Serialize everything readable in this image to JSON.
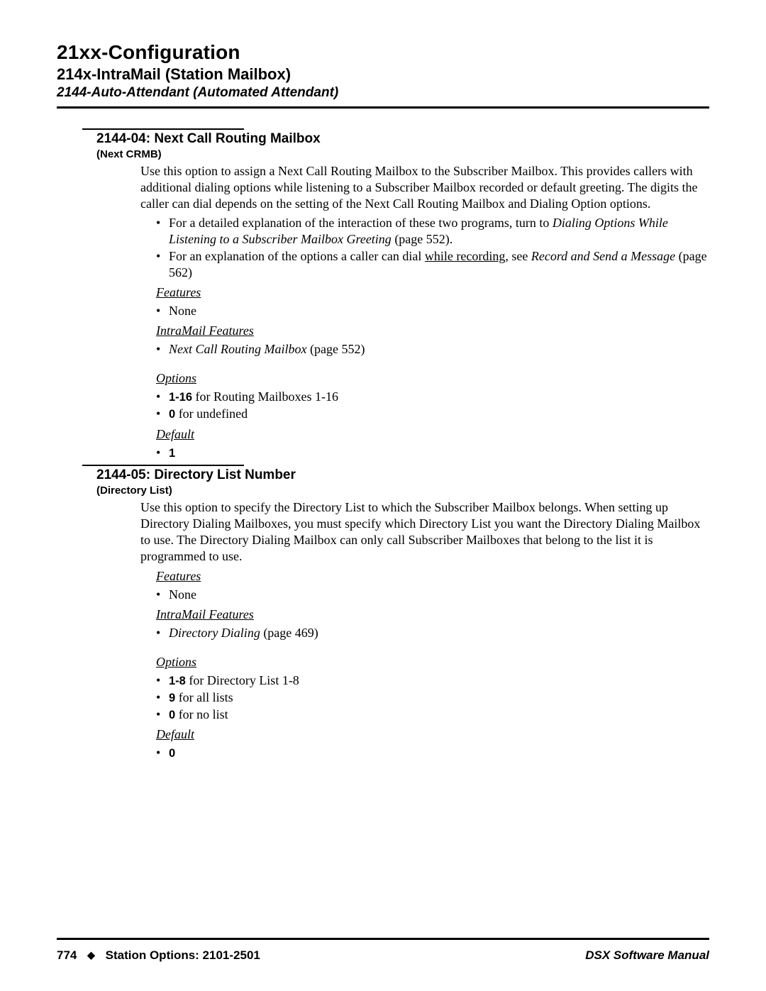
{
  "header": {
    "h1": "21xx-Configuration",
    "h2": "214x-IntraMail (Station Mailbox)",
    "h3": "2144-Auto-Attendant (Automated Attendant)"
  },
  "sections": [
    {
      "title": "2144-04: Next Call Routing Mailbox",
      "sub": "(Next CRMB)",
      "para": "Use this option to assign a Next Call Routing Mailbox to the Subscriber Mailbox. This provides callers with additional dialing options while listening to a Subscriber Mailbox recorded or default greeting. The digits the caller can dial depends on the setting of the Next Call Routing Mailbox and Dialing Option options.",
      "detail_bullets": [
        {
          "pre": "For a detailed explanation of the interaction of these two programs, turn to ",
          "em": "Dialing Options While Listening to a Subscriber Mailbox Greeting",
          "post": " (page 552)."
        },
        {
          "pre": "For an explanation of the options a caller can dial ",
          "uline": "while recording",
          "mid": ", see ",
          "em": "Record and Send a Message",
          "post": " (page 562)"
        }
      ],
      "features_label": "Features",
      "features": [
        "None"
      ],
      "intramail_label": "IntraMail Features",
      "intramail": [
        {
          "em": "Next Call Routing Mailbox",
          "post": " (page 552)"
        }
      ],
      "options_label": "Options",
      "options": [
        {
          "bold": "1-16",
          "rest": " for Routing Mailboxes 1-16"
        },
        {
          "bold": "0",
          "rest": " for undefined"
        }
      ],
      "default_label": "Default",
      "default": [
        "1"
      ]
    },
    {
      "title": "2144-05: Directory List Number",
      "sub": "(Directory List)",
      "para": "Use this option to specify the Directory List to which the Subscriber Mailbox belongs. When setting up Directory Dialing Mailboxes, you must specify which Directory List you want the Directory Dialing Mailbox to use. The Directory Dialing Mailbox can only call Subscriber Mailboxes that belong to the list it is programmed to use.",
      "features_label": "Features",
      "features": [
        "None"
      ],
      "intramail_label": "IntraMail Features",
      "intramail": [
        {
          "em": "Directory Dialing",
          "post": " (page 469)"
        }
      ],
      "options_label": "Options",
      "options": [
        {
          "bold": "1-8",
          "rest": " for Directory List 1-8"
        },
        {
          "bold": "9",
          "rest": " for all lists"
        },
        {
          "bold": "0",
          "rest": " for no list"
        }
      ],
      "default_label": "Default",
      "default": [
        "0"
      ]
    }
  ],
  "footer": {
    "page": "774",
    "left": "Station Options: 2101-2501",
    "right": "DSX Software Manual"
  }
}
